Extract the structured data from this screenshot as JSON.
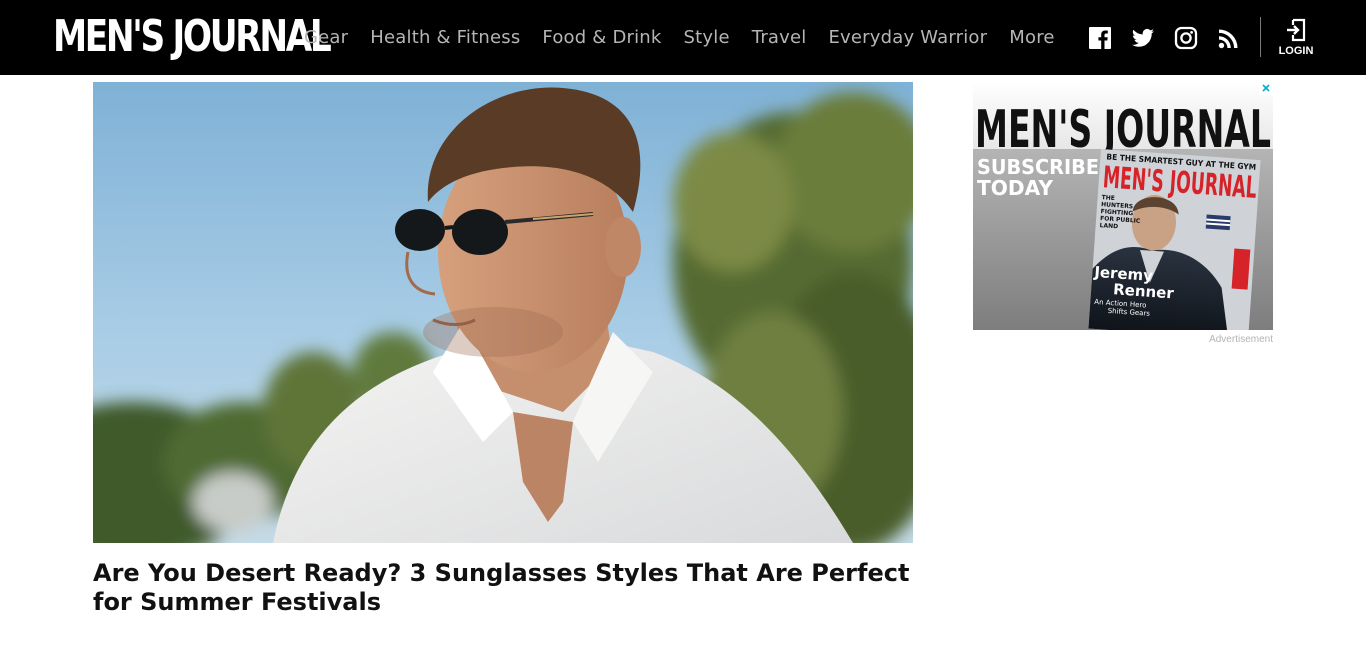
{
  "header": {
    "logo": "MEN'S JOURNAL",
    "nav": [
      "Gear",
      "Health & Fitness",
      "Food & Drink",
      "Style",
      "Travel",
      "Everyday Warrior",
      "More"
    ],
    "social_icons": [
      "facebook-icon",
      "twitter-icon",
      "instagram-icon",
      "rss-icon"
    ],
    "login_label": "LOGIN"
  },
  "article": {
    "headline": "Are You Desert Ready? 3 Sunglasses Styles That Are Perfect for Summer Festivals"
  },
  "ad": {
    "brand": "MEN'S JOURNAL",
    "cta_line1": "SUBSCRIBE",
    "cta_line2": "TODAY",
    "cover_tagline": "BE THE SMARTEST GUY AT THE GYM",
    "cover_masthead": "MEN'S JOURNAL",
    "cover_name_first": "Jeremy",
    "cover_name_last": "Renner",
    "cover_sub1": "An Action Hero",
    "cover_sub2": "Shifts Gears",
    "cover_left1": "THE",
    "cover_left2": "HUNTERS",
    "cover_left3": "FIGHTING",
    "cover_left4": "FOR PUBLIC",
    "cover_left5": "LAND",
    "label": "Advertisement"
  },
  "colors": {
    "header_bg": "#000000",
    "nav_text": "#b5b5b5",
    "headline_text": "#111111",
    "cover_red": "#d6232a",
    "ad_gray": "#808080"
  }
}
